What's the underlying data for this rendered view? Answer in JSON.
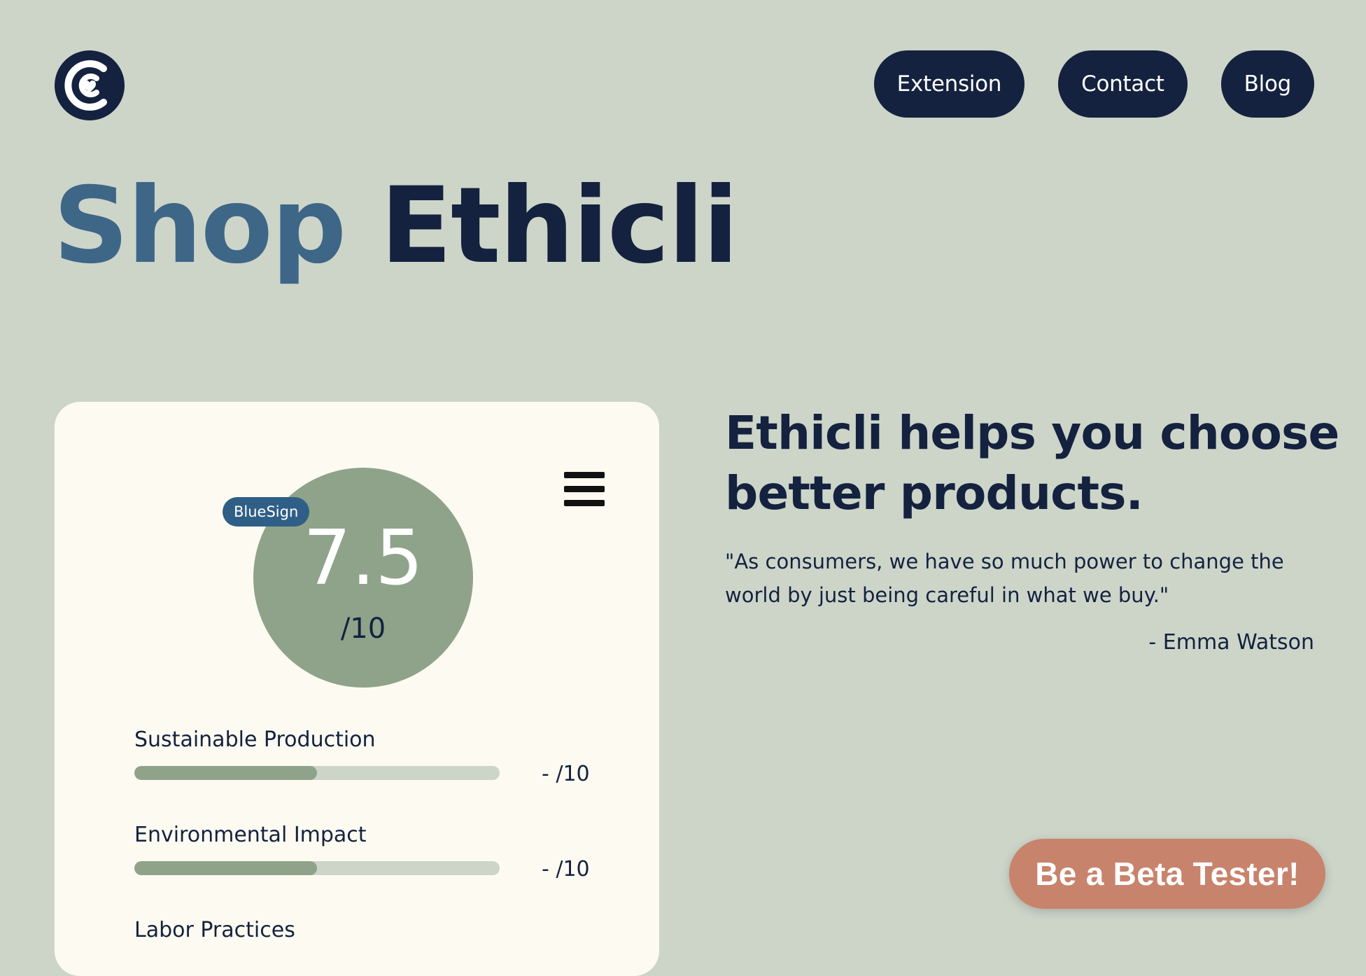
{
  "header": {
    "logo_icon": "ethicli-heart-logo-icon",
    "nav": [
      {
        "label": "Extension"
      },
      {
        "label": "Contact"
      },
      {
        "label": "Blog"
      }
    ]
  },
  "hero": {
    "title_part1": "Shop",
    "title_part2": "Ethicli"
  },
  "card": {
    "menu_icon": "hamburger-menu-icon",
    "badge": "BlueSign",
    "score": "7.5",
    "score_max": "/10",
    "metrics": [
      {
        "label": "Sustainable Production",
        "score": "- /10",
        "fill_fraction": 0.5
      },
      {
        "label": "Environmental Impact",
        "score": "- /10",
        "fill_fraction": 0.5
      },
      {
        "label": "Labor Practices"
      }
    ]
  },
  "about": {
    "headline": "Ethicli helps you choose better products.",
    "quote": "\"As consumers, we have so much power to change the world by just being careful in what we buy.\"",
    "author": "- Emma Watson"
  },
  "cta": {
    "label": "Be a Beta Tester!"
  },
  "colors": {
    "background": "#cdd5c9",
    "navy": "#14223f",
    "blue": "#3e6687",
    "sage": "#8fa38a",
    "card": "#fdfbf1",
    "cta": "#c8836c"
  }
}
